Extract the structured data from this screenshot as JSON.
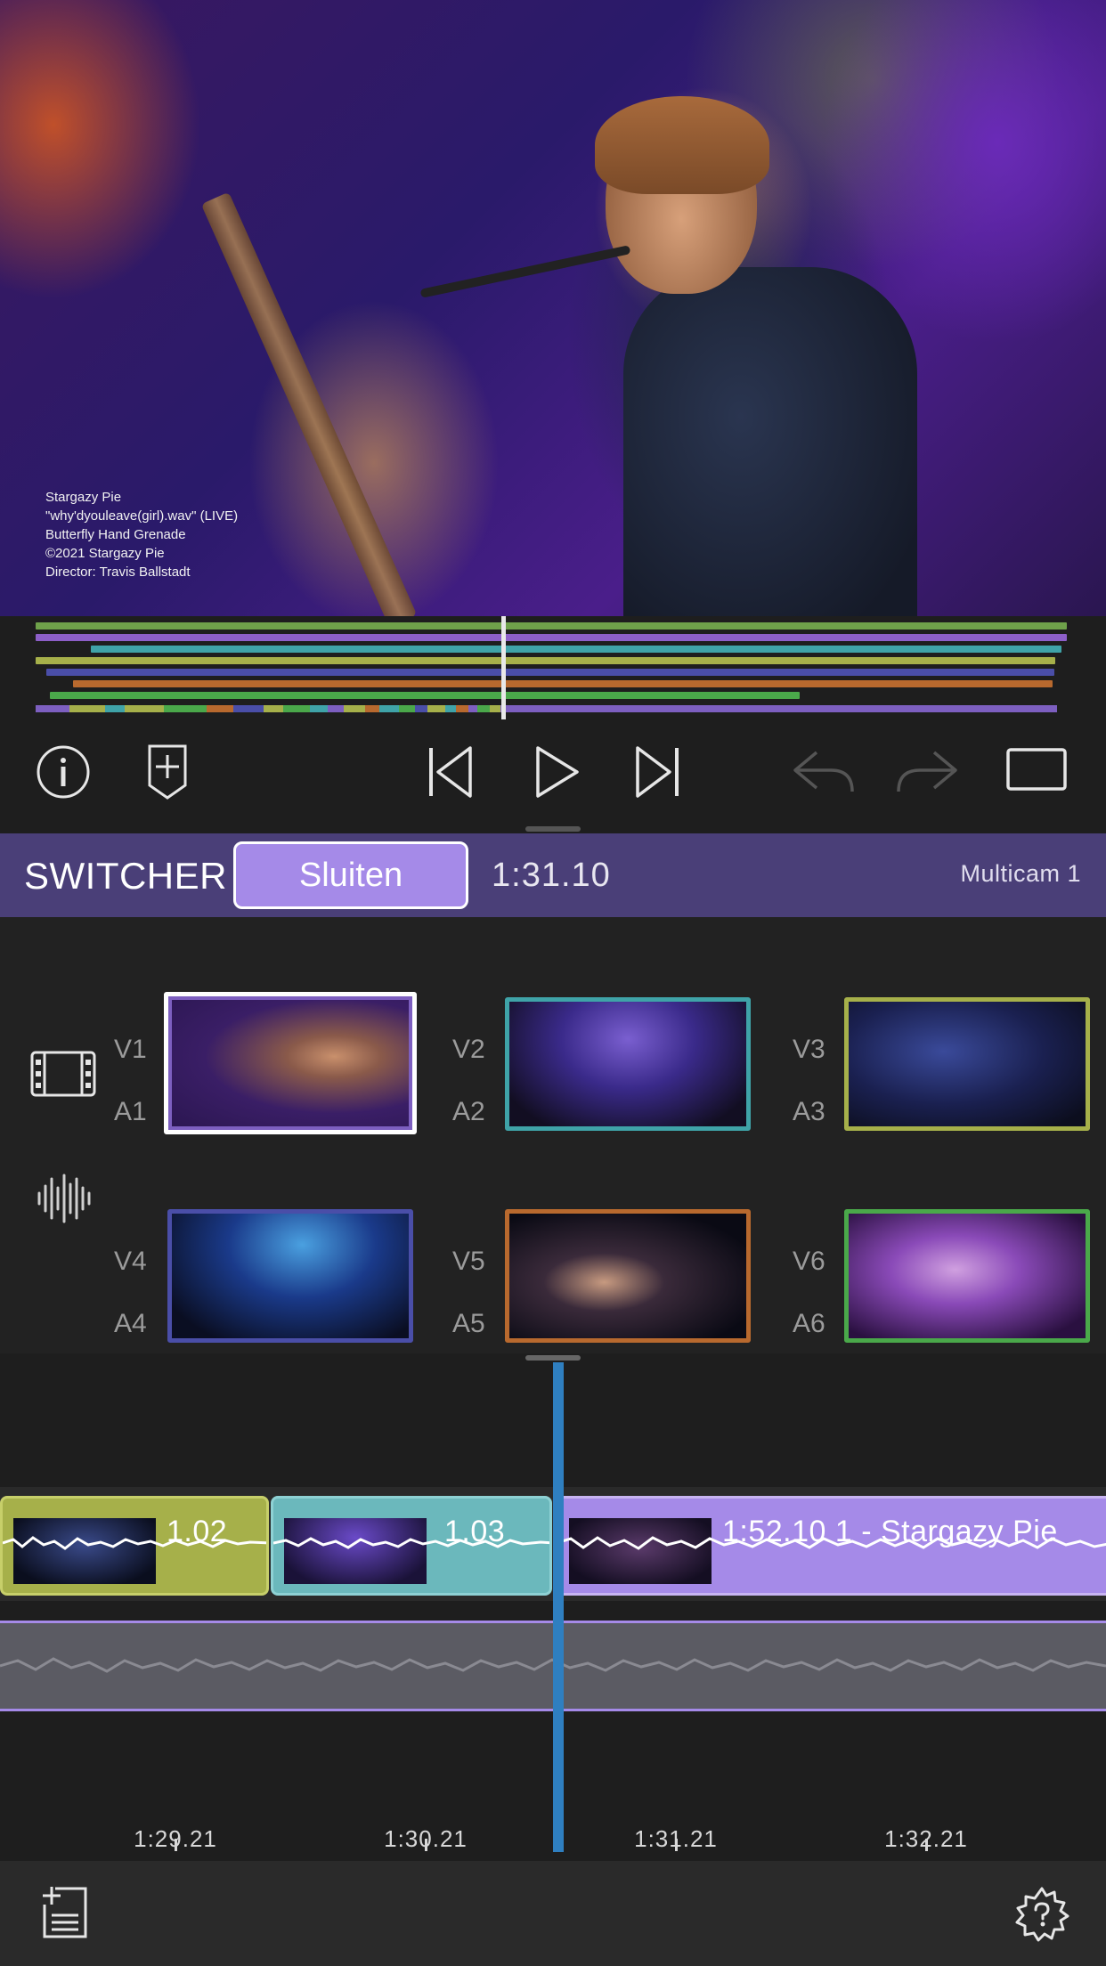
{
  "viewer": {
    "credits": [
      "Stargazy Pie",
      "\"why'dyouleave(girl).wav\" (LIVE)",
      "Butterfly Hand Grenade",
      "©2021 Stargazy Pie",
      "Director: Travis Ballstadt"
    ]
  },
  "transport": {
    "icons": [
      "info-icon",
      "add-marker-icon",
      "skip-back-icon",
      "play-icon",
      "skip-forward-icon",
      "undo-icon",
      "redo-icon",
      "fullscreen-icon"
    ]
  },
  "switcher": {
    "title": "SWITCHER",
    "close_label": "Sluiten",
    "timecode": "1:31.10",
    "multicam_name": "Multicam 1"
  },
  "angles": [
    {
      "video": "V1",
      "audio": "A1",
      "color": "#7d5fc0",
      "active": true
    },
    {
      "video": "V2",
      "audio": "A2",
      "color": "#3fa3a8",
      "active": false
    },
    {
      "video": "V3",
      "audio": "A3",
      "color": "#a6b04a",
      "active": false
    },
    {
      "video": "V4",
      "audio": "A4",
      "color": "#4a4ea8",
      "active": false
    },
    {
      "video": "V5",
      "audio": "A5",
      "color": "#b8692e",
      "active": false
    },
    {
      "video": "V6",
      "audio": "A6",
      "color": "#4aa84a",
      "active": false
    }
  ],
  "timeline": {
    "clips": [
      {
        "label": "1.02",
        "color": "#a6b04a"
      },
      {
        "label": "1.03",
        "color": "#6bb8bc"
      },
      {
        "label": "1:52.10   1 - Stargazy Pie",
        "color": "#a58ae8"
      }
    ],
    "ruler": [
      "1:29.21",
      "1:30.21",
      "1:31.21",
      "1:32.21"
    ]
  },
  "colors": {
    "accent": "#a58ae8",
    "switcher_bar": "#4a3f78",
    "playhead": "#2f7fc0"
  }
}
